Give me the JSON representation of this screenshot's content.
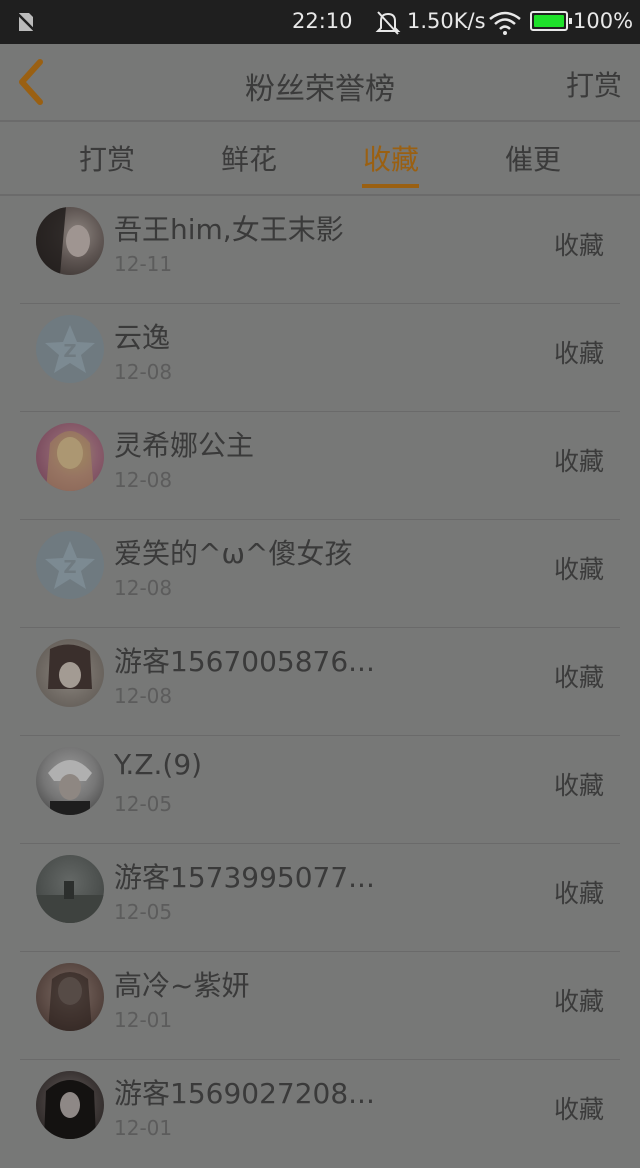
{
  "status_bar": {
    "time": "22:10",
    "net_speed": "1.50K/s",
    "battery": "100%",
    "battery_color": "#1ee02a"
  },
  "header": {
    "back_icon": "chevron-left-icon",
    "title": "粉丝荣誉榜",
    "right_action": "打赏"
  },
  "tabs": [
    {
      "label": "打赏",
      "active": false
    },
    {
      "label": "鲜花",
      "active": false
    },
    {
      "label": "收藏",
      "active": true
    },
    {
      "label": "催更",
      "active": false
    }
  ],
  "accent_color": "#9a6012",
  "fans": [
    {
      "name": "吾王him,女王末影",
      "date": "12-11",
      "action": "收藏",
      "avatar": "photo"
    },
    {
      "name": "云逸",
      "date": "12-08",
      "action": "收藏",
      "avatar": "default-star"
    },
    {
      "name": "灵希娜公主",
      "date": "12-08",
      "action": "收藏",
      "avatar": "photo"
    },
    {
      "name": "爱笑的^ω^傻女孩",
      "date": "12-08",
      "action": "收藏",
      "avatar": "default-star"
    },
    {
      "name": "游客1567005876...",
      "date": "12-08",
      "action": "收藏",
      "avatar": "photo"
    },
    {
      "name": "Y.Z.(9)",
      "date": "12-05",
      "action": "收藏",
      "avatar": "photo"
    },
    {
      "name": "游客1573995077...",
      "date": "12-05",
      "action": "收藏",
      "avatar": "photo"
    },
    {
      "name": "高冷~紫妍",
      "date": "12-01",
      "action": "收藏",
      "avatar": "photo"
    },
    {
      "name": "游客1569027208...",
      "date": "12-01",
      "action": "收藏",
      "avatar": "photo"
    }
  ]
}
